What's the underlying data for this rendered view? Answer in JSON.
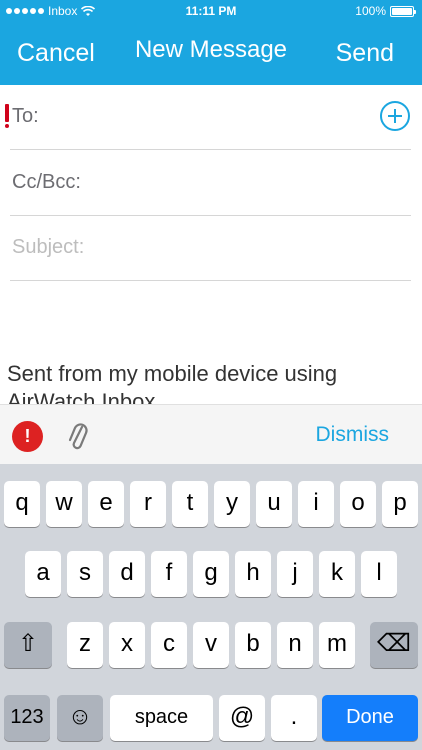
{
  "status_bar": {
    "carrier": "Inbox",
    "time": "11:11 PM",
    "battery": "100%"
  },
  "nav": {
    "cancel": "Cancel",
    "title": "New Message",
    "send": "Send"
  },
  "fields": {
    "to_label": "To:",
    "cc_label": "Cc/Bcc:",
    "subject_placeholder": "Subject:"
  },
  "body": {
    "text": "Sent from my mobile device using AirWatch Inbox"
  },
  "action_bar": {
    "warning_symbol": "!",
    "dismiss": "Dismiss"
  },
  "keyboard": {
    "row1": [
      "q",
      "w",
      "e",
      "r",
      "t",
      "y",
      "u",
      "i",
      "o",
      "p"
    ],
    "row2": [
      "a",
      "s",
      "d",
      "f",
      "g",
      "h",
      "j",
      "k",
      "l"
    ],
    "row3": [
      "z",
      "x",
      "c",
      "v",
      "b",
      "n",
      "m"
    ],
    "shift_symbol": "⇧",
    "delete_symbol": "⌫",
    "numbers": "123",
    "emoji": "☺",
    "space": "space",
    "at": "@",
    "period": ".",
    "done": "Done"
  },
  "colors": {
    "accent": "#1ba6e0",
    "required": "#d0021b",
    "done_key": "#147efb"
  }
}
